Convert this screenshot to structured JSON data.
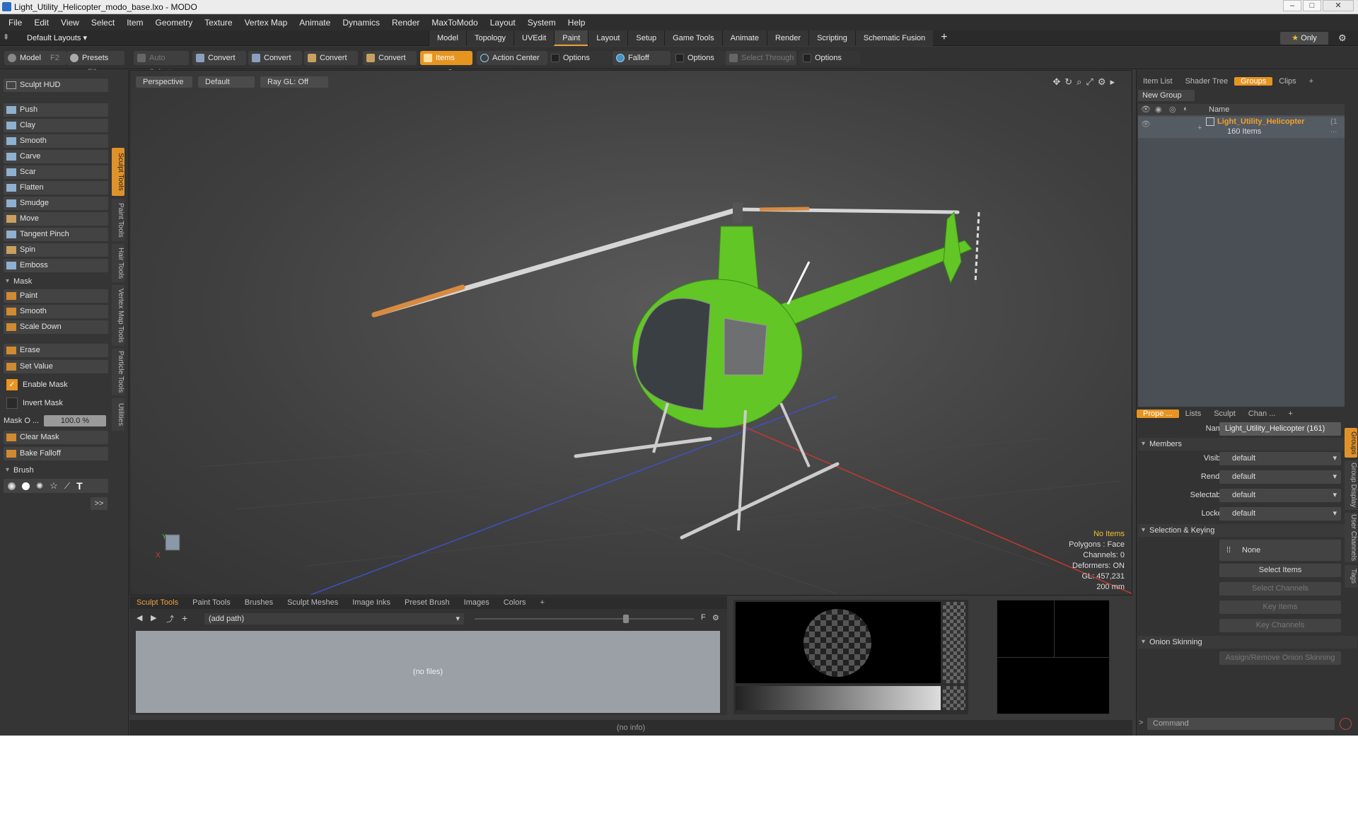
{
  "window": {
    "title": "Light_Utility_Helicopter_modo_base.lxo - MODO"
  },
  "menu": [
    "File",
    "Edit",
    "View",
    "Select",
    "Item",
    "Geometry",
    "Texture",
    "Vertex Map",
    "Animate",
    "Dynamics",
    "Render",
    "MaxToModo",
    "Layout",
    "System",
    "Help"
  ],
  "layout": {
    "default_layouts": "Default Layouts",
    "tabs": [
      "Model",
      "Topology",
      "UVEdit",
      "Paint",
      "Layout",
      "Setup",
      "Game Tools",
      "Animate",
      "Render",
      "Scripting",
      "Schematic Fusion"
    ],
    "active_tab": "Paint",
    "plus": "+",
    "only": "Only"
  },
  "toolbar": {
    "model": "Model",
    "model_key": "F2",
    "presets": "Presets",
    "presets_key": "F6",
    "auto_select": "Auto Select",
    "convert1": "Convert",
    "convert2": "Convert",
    "convert3": "Convert",
    "convert4": "Convert",
    "items": "Items",
    "items_key": "5",
    "action_center": "Action Center",
    "options1": "Options",
    "falloff": "Falloff",
    "options2": "Options",
    "select_through": "Select Through",
    "options3": "Options"
  },
  "left": {
    "sculpt_hud": "Sculpt HUD",
    "tools": [
      "Push",
      "Clay",
      "Smooth",
      "Carve",
      "Scar",
      "Flatten",
      "Smudge",
      "Move",
      "Tangent Pinch",
      "Spin",
      "Emboss"
    ],
    "mask_section": "Mask",
    "mask_tools": [
      "Paint",
      "Smooth",
      "Scale Down"
    ],
    "erase": "Erase",
    "set_value": "Set Value",
    "enable_mask": "Enable Mask",
    "invert_mask": "Invert Mask",
    "mask_opacity_label": "Mask O ...",
    "mask_opacity": "100.0 %",
    "clear_mask": "Clear Mask",
    "bake_falloff": "Bake Falloff",
    "brush_section": "Brush",
    "more": ">>",
    "vtabs": [
      "Sculpt Tools",
      "Paint Tools",
      "Hair Tools",
      "Vertex Map Tools",
      "Particle Tools",
      "Utilities"
    ]
  },
  "viewport": {
    "view": "Perspective",
    "style": "Default",
    "raygl": "Ray GL: Off",
    "info": {
      "no_items": "No Items",
      "polygons": "Polygons : Face",
      "channels": "Channels: 0",
      "deformers": "Deformers: ON",
      "gl": "GL: 457,231",
      "scale": "200 mm"
    }
  },
  "bottom": {
    "tabs": [
      "Sculpt Tools",
      "Paint Tools",
      "Brushes",
      "Sculpt Meshes",
      "Image Inks",
      "Preset Brush",
      "Images",
      "Colors",
      "+"
    ],
    "path": "(add path)",
    "nofiles": "(no files)",
    "status": "(no info)"
  },
  "right": {
    "tabs": [
      "Item List",
      "Shader Tree",
      "Groups",
      "Clips",
      "+"
    ],
    "new_group": "New Group",
    "col_name": "Name",
    "group_name": "Light_Utility_Helicopter",
    "group_suffix": "(1 ...",
    "group_count": "160 Items",
    "prop_tabs": [
      "Prope ...",
      "Lists",
      "Sculpt",
      "Chan ...",
      "+"
    ],
    "name_label": "Name",
    "name_value": "Light_Utility_Helicopter (161)",
    "members": "Members",
    "visible_label": "Visible",
    "render_label": "Render",
    "selectable_label": "Selectable",
    "locked_label": "Locked",
    "default_val": "default",
    "sel_keying": "Selection & Keying",
    "none": "None",
    "select_items": "Select Items",
    "select_channels": "Select Channels",
    "key_items": "Key Items",
    "key_channels": "Key Channels",
    "onion": "Onion Skinning",
    "assign_onion": "Assign/Remove Onion Skinning",
    "side_vtabs": [
      "Groups",
      "Group Display",
      "User Channels",
      "Tags"
    ],
    "command_placeholder": "Command"
  },
  "colors": {
    "accent": "#e79521",
    "helicopter": "#62c626",
    "warn": "#f0c030"
  }
}
